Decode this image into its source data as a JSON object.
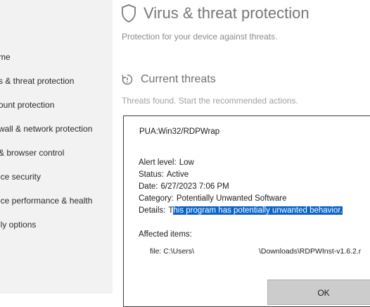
{
  "page": {
    "title": "Virus & threat protection",
    "subtitle": "Protection for your device against threats."
  },
  "nav": {
    "items": [
      "me",
      "s & threat protection",
      "ount protection",
      "wall & network protection",
      "& browser control",
      "ice security",
      "ice performance & health",
      "ily options"
    ]
  },
  "section": {
    "title": "Current threats",
    "subtitle": "Threats found. Start the recommended actions."
  },
  "dialog": {
    "threat_name": "PUA:Win32/RDPWrap",
    "alert_level_label": "Alert level:",
    "alert_level_value": "Low",
    "status_label": "Status:",
    "status_value": "Active",
    "date_label": "Date:",
    "date_value": "6/27/2023 7:06 PM",
    "category_label": "Category:",
    "category_value": "Potentially Unwanted Software",
    "details_label": "Details:",
    "details_first_char": "T",
    "details_rest": "his program has potentially unwanted behavior.",
    "affected_label": "Affected items:",
    "file_prefix": "file: C:\\Users\\",
    "file_suffix": "\\Downloads\\RDPWInst-v1.6.2.r",
    "ok_label": "OK"
  },
  "colors": {
    "highlight": "#0a64c8",
    "nav_bg": "#f2f2f2"
  }
}
